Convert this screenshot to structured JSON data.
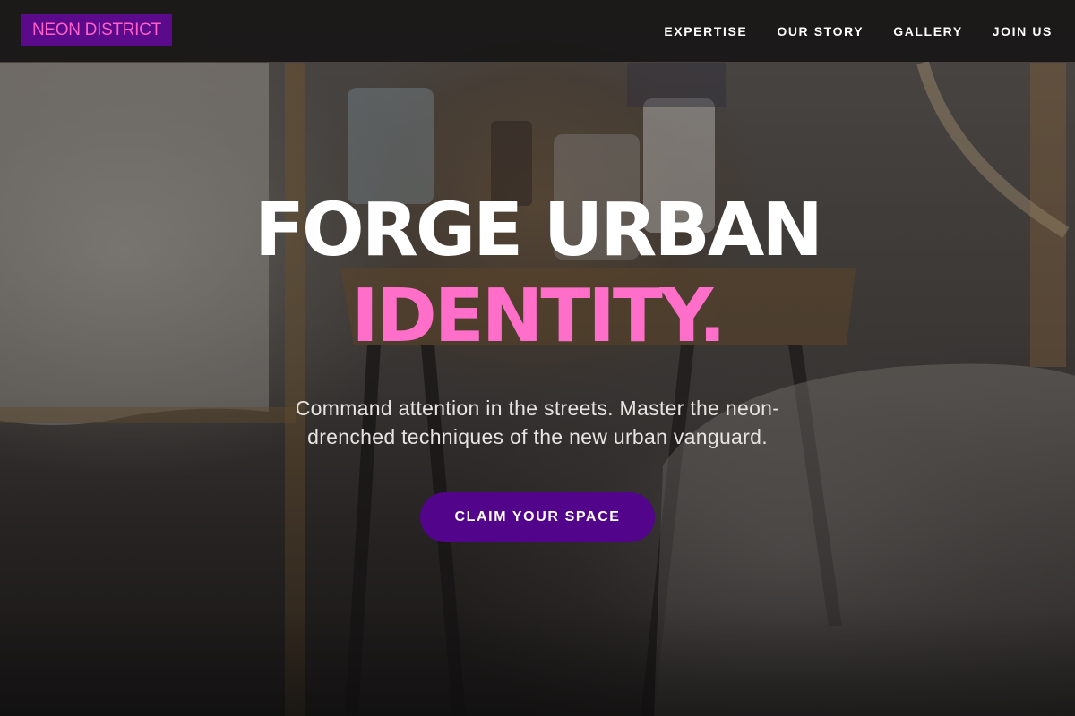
{
  "brand": {
    "name": "NEON DISTRICT"
  },
  "nav": {
    "items": [
      {
        "label": "EXPERTISE"
      },
      {
        "label": "OUR STORY"
      },
      {
        "label": "GALLERY"
      },
      {
        "label": "JOIN US"
      }
    ]
  },
  "hero": {
    "headline_line1": "FORGE URBAN",
    "headline_line2": "IDENTITY.",
    "subtitle": "Command attention in the streets. Master the neon-drenched techniques of the new urban vanguard.",
    "cta_label": "CLAIM YOUR SPACE"
  },
  "colors": {
    "brand_bg": "#5a0a8a",
    "brand_text": "#ff5fc7",
    "accent_pink": "#ff6ec8",
    "cta_bg": "#52048a"
  }
}
